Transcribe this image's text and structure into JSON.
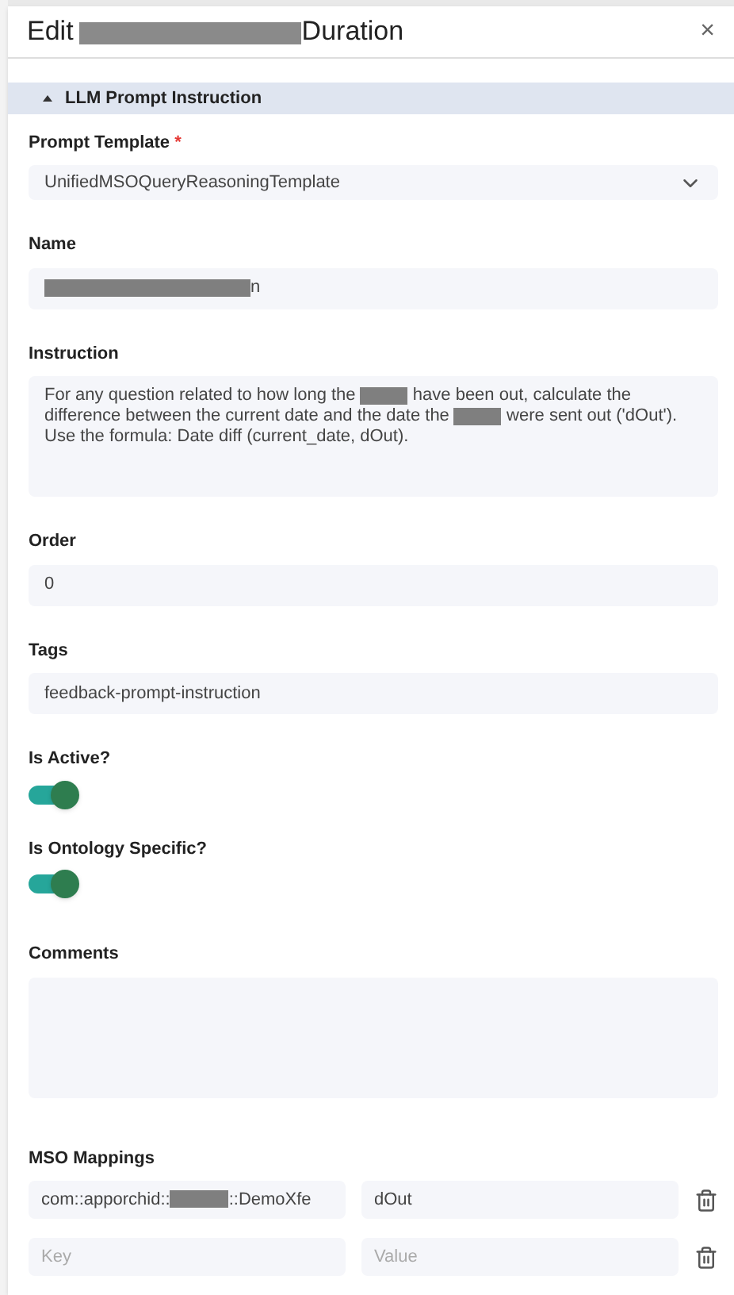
{
  "dialog": {
    "title": [
      {
        "kind": "text",
        "text": "Edit"
      },
      {
        "kind": "redacted"
      },
      {
        "kind": "text",
        "text": "Duration"
      }
    ],
    "close": "×"
  },
  "section": {
    "title": "LLM Prompt Instruction",
    "expanded": true
  },
  "fields": [
    {
      "kind": "select",
      "label": "Prompt Template",
      "required_mark": "*",
      "value": [
        {
          "kind": "text",
          "text": "UnifiedMSOQueryReasoningTemplate"
        }
      ]
    },
    {
      "kind": "input",
      "label": "Name",
      "value": [
        {
          "kind": "redacted"
        },
        {
          "kind": "text",
          "text": "n"
        }
      ]
    },
    {
      "kind": "textarea",
      "label": "Instruction",
      "value": [
        {
          "kind": "text",
          "text": "For any question related to how long the "
        },
        {
          "kind": "redacted"
        },
        {
          "kind": "text",
          "text": " have been out, calculate the difference between the current date and the date the "
        },
        {
          "kind": "redacted"
        },
        {
          "kind": "text",
          "text": " were sent out ('dOut'). Use the formula: Date diff (current_date, dOut)."
        }
      ]
    },
    {
      "kind": "input",
      "label": "Order",
      "value": [
        {
          "kind": "text",
          "text": "0"
        }
      ]
    },
    {
      "kind": "input",
      "label": "Tags",
      "value": [
        {
          "kind": "text",
          "text": "feedback-prompt-instruction"
        }
      ]
    },
    {
      "kind": "switch",
      "label": "Is Active?",
      "on": true
    },
    {
      "kind": "switch",
      "label": "Is Ontology Specific?",
      "on": true
    },
    {
      "kind": "comments",
      "label": "Comments"
    }
  ],
  "mappings": {
    "label": "MSO Mappings",
    "rows": [
      {
        "key": [
          {
            "kind": "text",
            "text": "com::apporchid::"
          },
          {
            "kind": "redacted"
          },
          {
            "kind": "text",
            "text": "::DemoXfe"
          }
        ],
        "value": "dOut"
      },
      {
        "key_placeholder": "Key",
        "value_placeholder": "Value"
      }
    ]
  }
}
